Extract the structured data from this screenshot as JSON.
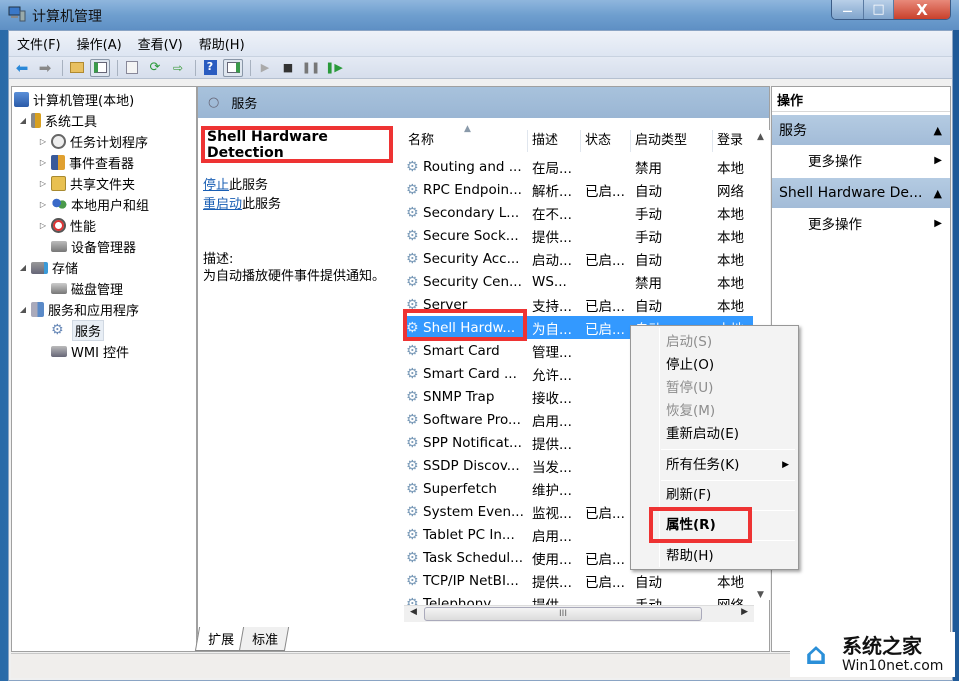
{
  "window": {
    "title": "计算机管理",
    "minimize": "—",
    "maximize": "□",
    "close": "X"
  },
  "menu": [
    "文件(F)",
    "操作(A)",
    "查看(V)",
    "帮助(H)"
  ],
  "toolbar": {
    "icons": [
      "back-arrow-icon",
      "forward-arrow-icon",
      "up-folder-icon",
      "show-hide-tree-icon",
      "properties-icon",
      "refresh-icon",
      "export-list-icon",
      "help-icon",
      "show-hide-action-pane-icon",
      "start-service-icon",
      "stop-service-icon",
      "pause-service-icon",
      "resume-service-icon"
    ]
  },
  "tree": {
    "root": "计算机管理(本地)",
    "nodes": [
      {
        "label": "系统工具",
        "level": 1,
        "expanded": true
      },
      {
        "label": "任务计划程序",
        "level": 2,
        "collapsed": true
      },
      {
        "label": "事件查看器",
        "level": 2,
        "collapsed": true
      },
      {
        "label": "共享文件夹",
        "level": 2,
        "collapsed": true
      },
      {
        "label": "本地用户和组",
        "level": 2,
        "collapsed": true
      },
      {
        "label": "性能",
        "level": 2,
        "collapsed": true
      },
      {
        "label": "设备管理器",
        "level": 2
      },
      {
        "label": "存储",
        "level": 1,
        "expanded": true
      },
      {
        "label": "磁盘管理",
        "level": 2
      },
      {
        "label": "服务和应用程序",
        "level": 1,
        "expanded": true
      },
      {
        "label": "服务",
        "level": 2,
        "selected": true
      },
      {
        "label": "WMI 控件",
        "level": 2
      }
    ]
  },
  "middle": {
    "header": "服务",
    "service_title": "Shell Hardware Detection",
    "stop_link": "停止",
    "stop_suffix": "此服务",
    "restart_link": "重启动",
    "restart_suffix": "此服务",
    "desc_label": "描述:",
    "desc_text": "为自动播放硬件事件提供通知。",
    "columns": [
      "名称",
      "描述",
      "状态",
      "启动类型",
      "登录"
    ],
    "rows": [
      {
        "name": "Routing and ...",
        "desc": "在局...",
        "status": "",
        "type": "禁用",
        "logon": "本地"
      },
      {
        "name": "RPC Endpoin...",
        "desc": "解析...",
        "status": "已启...",
        "type": "自动",
        "logon": "网络"
      },
      {
        "name": "Secondary L...",
        "desc": "在不...",
        "status": "",
        "type": "手动",
        "logon": "本地"
      },
      {
        "name": "Secure Sock...",
        "desc": "提供...",
        "status": "",
        "type": "手动",
        "logon": "本地"
      },
      {
        "name": "Security Acc...",
        "desc": "启动...",
        "status": "已启...",
        "type": "自动",
        "logon": "本地"
      },
      {
        "name": "Security Cen...",
        "desc": "WS...",
        "status": "",
        "type": "禁用",
        "logon": "本地"
      },
      {
        "name": "Server",
        "desc": "支持...",
        "status": "已启...",
        "type": "自动",
        "logon": "本地"
      },
      {
        "name": "Shell Hardw...",
        "desc": "为自...",
        "status": "已启...",
        "type": "自动",
        "logon": "本地",
        "selected": true
      },
      {
        "name": "Smart Card",
        "desc": "管理...",
        "status": "",
        "type": "",
        "logon": ""
      },
      {
        "name": "Smart Card ...",
        "desc": "允许...",
        "status": "",
        "type": "",
        "logon": ""
      },
      {
        "name": "SNMP Trap",
        "desc": "接收...",
        "status": "",
        "type": "",
        "logon": ""
      },
      {
        "name": "Software Pro...",
        "desc": "启用...",
        "status": "",
        "type": "",
        "logon": ""
      },
      {
        "name": "SPP Notificat...",
        "desc": "提供...",
        "status": "",
        "type": "",
        "logon": ""
      },
      {
        "name": "SSDP Discov...",
        "desc": "当发...",
        "status": "",
        "type": "",
        "logon": ""
      },
      {
        "name": "Superfetch",
        "desc": "维护...",
        "status": "",
        "type": "",
        "logon": ""
      },
      {
        "name": "System Even...",
        "desc": "监视...",
        "status": "已启...",
        "type": "",
        "logon": ""
      },
      {
        "name": "Tablet PC In...",
        "desc": "启用...",
        "status": "",
        "type": "",
        "logon": ""
      },
      {
        "name": "Task Schedul...",
        "desc": "使用...",
        "status": "已启...",
        "type": "",
        "logon": ""
      },
      {
        "name": "TCP/IP NetBI...",
        "desc": "提供...",
        "status": "已启...",
        "type": "自动",
        "logon": "本地"
      },
      {
        "name": "Telephony",
        "desc": "提供...",
        "status": "",
        "type": "手动",
        "logon": "网络"
      }
    ],
    "hscroll_grip": "III",
    "tabs": [
      "扩展",
      "标准"
    ]
  },
  "actions": {
    "header": "操作",
    "groups": [
      {
        "title": "服务",
        "item": "更多操作"
      },
      {
        "title": "Shell Hardware De...",
        "item": "更多操作"
      }
    ]
  },
  "context_menu": {
    "items": [
      {
        "label": "启动(S)",
        "disabled": true
      },
      {
        "label": "停止(O)",
        "disabled": false
      },
      {
        "label": "暂停(U)",
        "disabled": true
      },
      {
        "label": "恢复(M)",
        "disabled": true
      },
      {
        "label": "重新启动(E)",
        "disabled": false
      },
      {
        "label": "所有任务(K)",
        "disabled": false,
        "submenu": true
      },
      {
        "label": "刷新(F)",
        "disabled": false
      },
      {
        "label": "属性(R)",
        "disabled": false,
        "bold": true,
        "highlighted": true
      },
      {
        "label": "帮助(H)",
        "disabled": false
      }
    ]
  },
  "watermark": {
    "cn": "系统之家",
    "en": "Win10net.com"
  },
  "colors": {
    "highlight": "#3399ff",
    "annotation": "#ee3333",
    "pane_header": "#a3bcd8",
    "link": "#1a5fb4"
  }
}
